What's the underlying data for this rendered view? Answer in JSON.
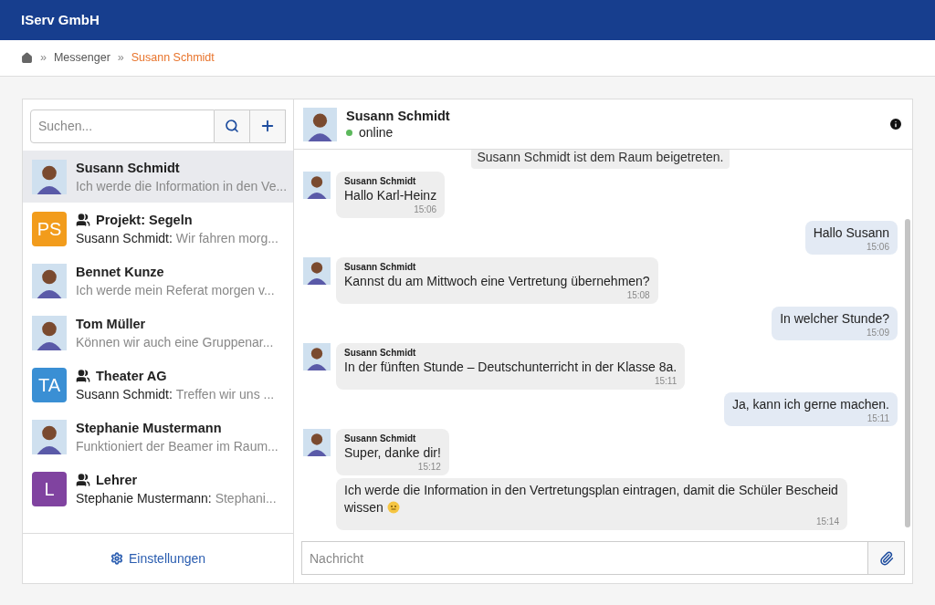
{
  "app_title": "IServ GmbH",
  "breadcrumb_separator": "»",
  "breadcrumb": [
    "Messenger",
    "Susann Schmidt"
  ],
  "sidebar": {
    "search": {
      "placeholder": "Suchen..."
    },
    "conversations": [
      {
        "name": "Susann Schmidt",
        "group": false,
        "preview": "Ich werde die Information in den Ve...",
        "selected": true,
        "avatar": {
          "kind": "person"
        }
      },
      {
        "name": "Projekt: Segeln",
        "group": true,
        "preview_sender": "Susann Schmidt:",
        "preview": "Wir fahren morg...",
        "selected": false,
        "avatar": {
          "kind": "initials",
          "initials": "PS",
          "color": "#f29c1c"
        }
      },
      {
        "name": "Bennet Kunze",
        "group": false,
        "preview": "Ich werde mein Referat morgen v...",
        "selected": false,
        "avatar": {
          "kind": "person"
        }
      },
      {
        "name": "Tom Müller",
        "group": false,
        "preview": "Können wir auch eine Gruppenar...",
        "selected": false,
        "avatar": {
          "kind": "person"
        }
      },
      {
        "name": "Theater AG",
        "group": true,
        "preview_sender": "Susann Schmidt:",
        "preview": "Treffen wir uns ...",
        "selected": false,
        "avatar": {
          "kind": "initials",
          "initials": "TA",
          "color": "#3a8fd4"
        }
      },
      {
        "name": "Stephanie Mustermann",
        "group": false,
        "preview": "Funktioniert der Beamer im Raum...",
        "selected": false,
        "avatar": {
          "kind": "person"
        }
      },
      {
        "name": "Lehrer",
        "group": true,
        "preview_sender": "Stephanie Mustermann:",
        "preview": "Stephani...",
        "selected": false,
        "avatar": {
          "kind": "initials",
          "initials": "L",
          "color": "#8043a0"
        }
      }
    ],
    "settings_link": "Einstellungen"
  },
  "chat": {
    "name": "Susann Schmidt",
    "status": "online",
    "online": true,
    "messages": [
      {
        "kind": "system",
        "text": "Susann Schmidt ist dem Raum beigetreten."
      },
      {
        "kind": "incoming",
        "sender": "Susann Schmidt",
        "text": "Hallo Karl-Heinz",
        "time": "15:06"
      },
      {
        "kind": "outgoing",
        "text": "Hallo Susann",
        "time": "15:06"
      },
      {
        "kind": "incoming",
        "sender": "Susann Schmidt",
        "text": "Kannst du am Mittwoch eine Vertretung übernehmen?",
        "time": "15:08"
      },
      {
        "kind": "outgoing",
        "text": "In welcher Stunde?",
        "time": "15:09"
      },
      {
        "kind": "incoming",
        "sender": "Susann Schmidt",
        "text": "In der fünften Stunde – Deutschunterricht in der Klasse 8a.",
        "time": "15:11"
      },
      {
        "kind": "outgoing",
        "text": "Ja, kann ich gerne machen.",
        "time": "15:11"
      },
      {
        "kind": "incoming",
        "sender": "Susann Schmidt",
        "text": "Super, danke dir!",
        "time": "15:12"
      },
      {
        "kind": "incoming",
        "text": "Ich werde die Information in den Vertretungsplan eintragen, damit die Schüler Bescheid wissen",
        "emoji": true,
        "time": "15:14"
      }
    ],
    "composer": {
      "placeholder": "Nachricht"
    }
  }
}
